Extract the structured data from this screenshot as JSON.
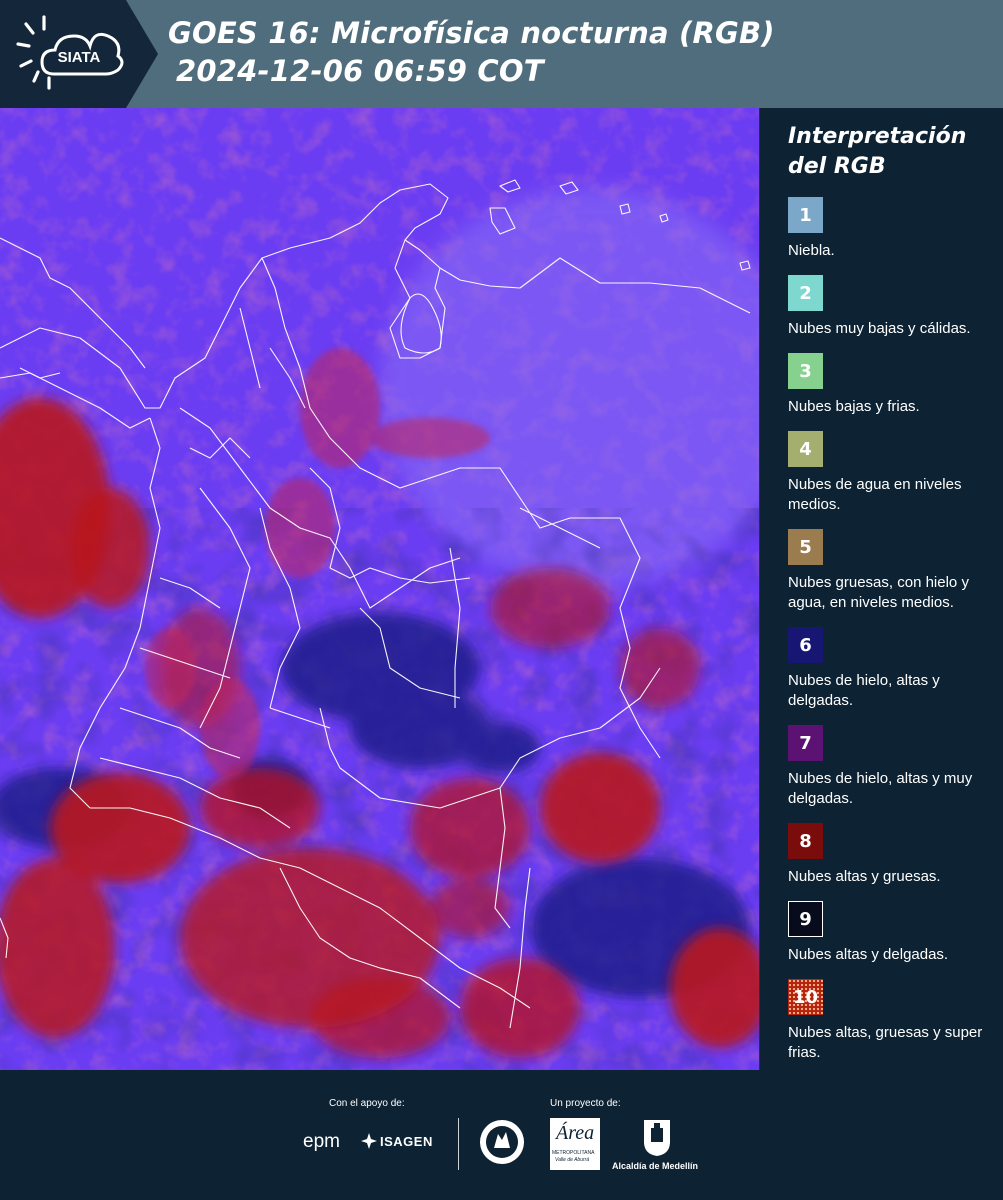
{
  "header": {
    "logo_text": "SIATA",
    "title_line1": "GOES 16: Microfísica nocturna (RGB)",
    "title_line2": "2024-12-06 06:59 COT"
  },
  "legend": {
    "title_line1": "Interpretación",
    "title_line2": "del RGB",
    "items": [
      {
        "number": "1",
        "label": "Niebla.",
        "color": "#7ba7c9"
      },
      {
        "number": "2",
        "label": "Nubes muy bajas y cálidas.",
        "color": "#7fd8cf"
      },
      {
        "number": "3",
        "label": "Nubes bajas y frias.",
        "color": "#86d18e"
      },
      {
        "number": "4",
        "label": "Nubes de agua en niveles medios.",
        "color": "#a4ae6e"
      },
      {
        "number": "5",
        "label": "Nubes gruesas, con hielo y agua, en niveles medios.",
        "color": "#9b7c4f"
      },
      {
        "number": "6",
        "label": "Nubes de hielo, altas y delgadas.",
        "color": "#171672"
      },
      {
        "number": "7",
        "label": "Nubes de hielo, altas y muy delgadas.",
        "color": "#5c1272"
      },
      {
        "number": "8",
        "label": "Nubes altas y gruesas.",
        "color": "#7a0d0b"
      },
      {
        "number": "9",
        "label": "Nubes altas y delgadas.",
        "color": "#080b1c"
      },
      {
        "number": "10",
        "label": "Nubes altas, gruesas y super frias.",
        "color": "#b32312"
      }
    ]
  },
  "footer": {
    "support_caption": "Con el apoyo de:",
    "project_caption": "Un proyecto de:",
    "epm_logo": "epm",
    "isagen_logo": "ISAGEN",
    "area_logo": "Área",
    "area_subtitle": "METROPOLITANA",
    "area_subtitle2": "Valle de Aburrá",
    "alcaldia_label": "Alcaldía de Medellín"
  }
}
